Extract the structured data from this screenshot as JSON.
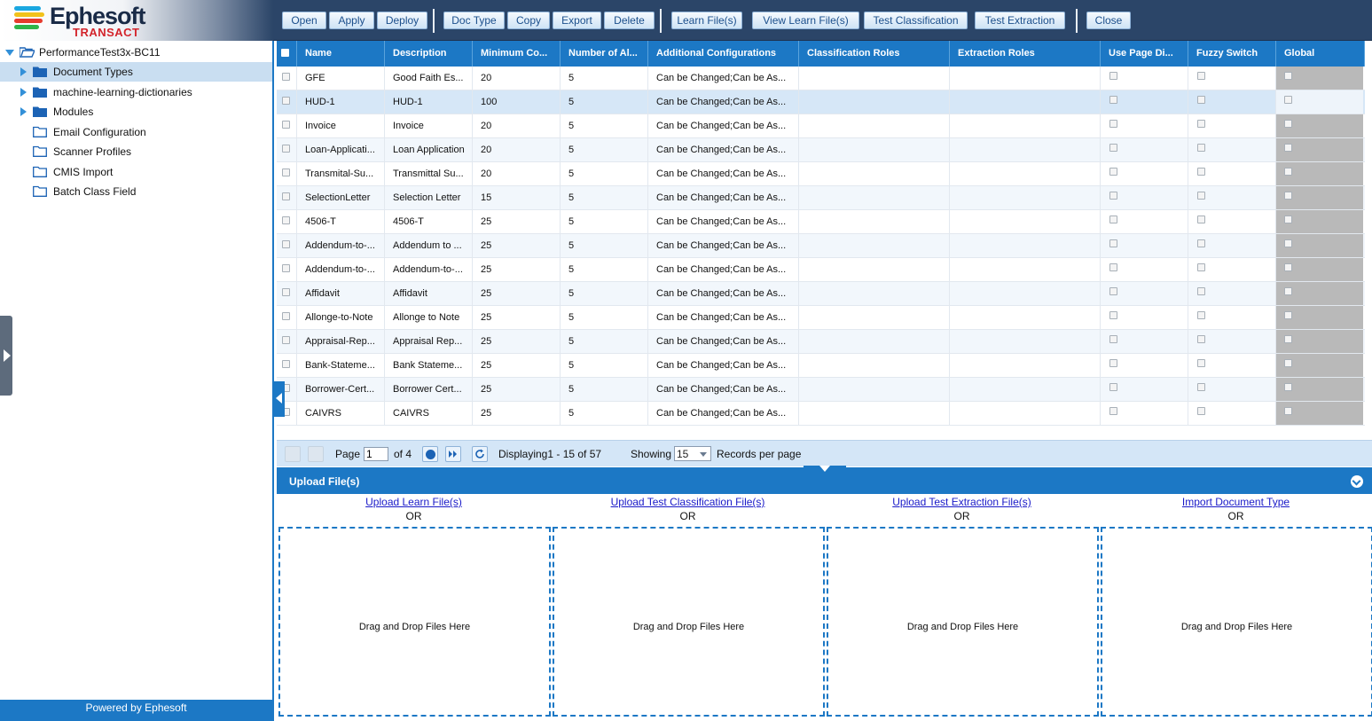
{
  "brand": {
    "name": "Ephesoft",
    "product": "TRANSACT",
    "colors": {
      "bar1": "#1aa7e0",
      "bar2": "#f2c21b",
      "bar3": "#e63b2e",
      "bar4": "#2fb44a"
    }
  },
  "toolbar": {
    "open": "Open",
    "apply": "Apply",
    "deploy": "Deploy",
    "doc_type": "Doc Type",
    "copy": "Copy",
    "export": "Export",
    "delete": "Delete",
    "learn_files": "Learn File(s)",
    "view_learn_files": "View Learn File(s)",
    "test_classification": "Test Classification",
    "test_extraction": "Test Extraction",
    "close": "Close"
  },
  "tree": {
    "root": "PerformanceTest3x-BC11",
    "items": [
      {
        "label": "Document Types",
        "expandable": true,
        "selected": true
      },
      {
        "label": "machine-learning-dictionaries",
        "expandable": true
      },
      {
        "label": "Modules",
        "expandable": true
      },
      {
        "label": "Email Configuration",
        "expandable": false
      },
      {
        "label": "Scanner Profiles",
        "expandable": false
      },
      {
        "label": "CMIS Import",
        "expandable": false
      },
      {
        "label": "Batch Class Field",
        "expandable": false
      }
    ]
  },
  "footer": {
    "powered": "Powered by Ephesoft"
  },
  "grid": {
    "columns": [
      "Name",
      "Description",
      "Minimum Co...",
      "Number of Al...",
      "Additional Configurations",
      "Classification Roles",
      "Extraction Roles",
      "Use Page Di...",
      "Fuzzy Switch",
      "Global"
    ],
    "rows": [
      {
        "name": "GFE",
        "desc": "Good Faith Es...",
        "min": "20",
        "num": "5",
        "config": "Can be Changed;Can be As..."
      },
      {
        "name": "HUD-1",
        "desc": "HUD-1",
        "min": "100",
        "num": "5",
        "config": "Can be Changed;Can be As..."
      },
      {
        "name": "Invoice",
        "desc": "Invoice",
        "min": "20",
        "num": "5",
        "config": "Can be Changed;Can be As..."
      },
      {
        "name": "Loan-Applicati...",
        "desc": "Loan Application",
        "min": "20",
        "num": "5",
        "config": "Can be Changed;Can be As..."
      },
      {
        "name": "Transmital-Su...",
        "desc": "Transmittal Su...",
        "min": "20",
        "num": "5",
        "config": "Can be Changed;Can be As..."
      },
      {
        "name": "SelectionLetter",
        "desc": "Selection Letter",
        "min": "15",
        "num": "5",
        "config": "Can be Changed;Can be As..."
      },
      {
        "name": "4506-T",
        "desc": "4506-T",
        "min": "25",
        "num": "5",
        "config": "Can be Changed;Can be As..."
      },
      {
        "name": "Addendum-to-...",
        "desc": "Addendum to ...",
        "min": "25",
        "num": "5",
        "config": "Can be Changed;Can be As..."
      },
      {
        "name": "Addendum-to-...",
        "desc": "Addendum-to-...",
        "min": "25",
        "num": "5",
        "config": "Can be Changed;Can be As..."
      },
      {
        "name": "Affidavit",
        "desc": "Affidavit",
        "min": "25",
        "num": "5",
        "config": "Can be Changed;Can be As..."
      },
      {
        "name": "Allonge-to-Note",
        "desc": "Allonge to Note",
        "min": "25",
        "num": "5",
        "config": "Can be Changed;Can be As..."
      },
      {
        "name": "Appraisal-Rep...",
        "desc": "Appraisal Rep...",
        "min": "25",
        "num": "5",
        "config": "Can be Changed;Can be As..."
      },
      {
        "name": "Bank-Stateme...",
        "desc": "Bank Stateme...",
        "min": "25",
        "num": "5",
        "config": "Can be Changed;Can be As..."
      },
      {
        "name": "Borrower-Cert...",
        "desc": "Borrower Cert...",
        "min": "25",
        "num": "5",
        "config": "Can be Changed;Can be As..."
      },
      {
        "name": "CAIVRS",
        "desc": "CAIVRS",
        "min": "25",
        "num": "5",
        "config": "Can be Changed;Can be As..."
      }
    ]
  },
  "pager": {
    "page_label": "Page",
    "page_value": "1",
    "of_label": "of 4",
    "displaying": "Displaying1 - 15 of 57",
    "showing_label": "Showing",
    "showing_value": "15",
    "per_page": "Records per page"
  },
  "upload": {
    "title": "Upload File(s)",
    "columns": [
      {
        "link": "Upload Learn File(s)",
        "or": "OR",
        "drop": "Drag and Drop Files Here"
      },
      {
        "link": "Upload Test Classification File(s)",
        "or": "OR",
        "drop": "Drag and Drop Files Here"
      },
      {
        "link": "Upload Test Extraction File(s)",
        "or": "OR",
        "drop": "Drag and Drop Files Here"
      },
      {
        "link": "Import Document Type",
        "or": "OR",
        "drop": "Drag and Drop Files Here"
      }
    ]
  }
}
